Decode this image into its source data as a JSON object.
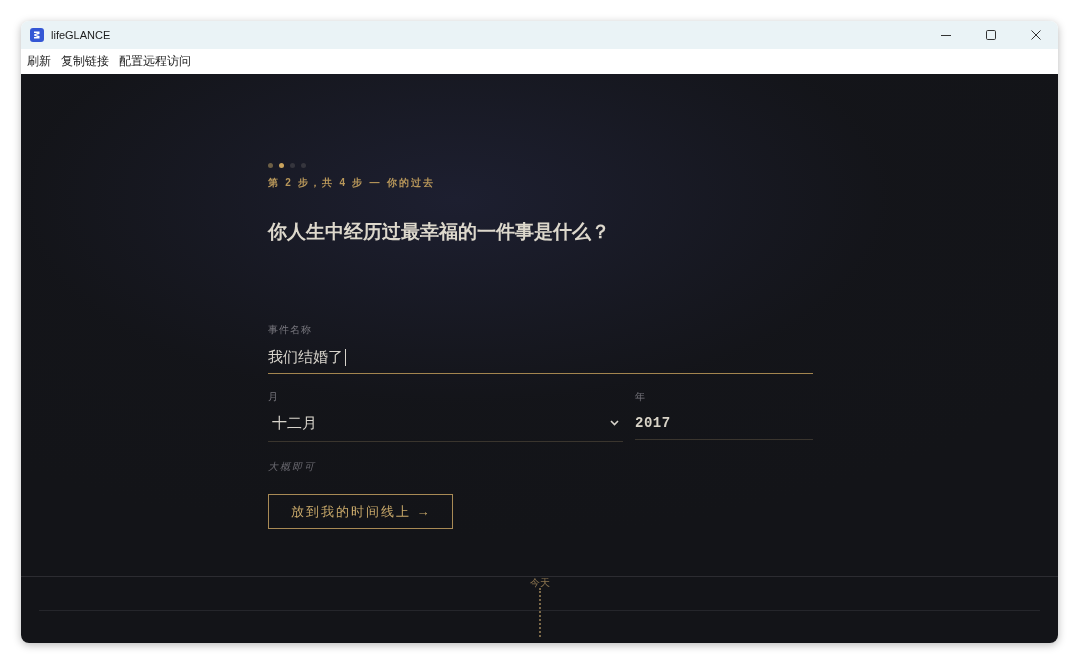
{
  "window": {
    "title": "lifeGLANCE"
  },
  "menu": [
    "刷新",
    "复制链接",
    "配置远程访问"
  ],
  "wizard": {
    "steps": [
      {
        "done": true,
        "selected": false
      },
      {
        "done": false,
        "selected": true
      },
      {
        "done": false,
        "selected": false
      },
      {
        "done": false,
        "selected": false
      }
    ],
    "step_label": "第 2 步，共 4 步 — 你的过去",
    "question": "你人生中经历过最幸福的一件事是什么？",
    "event_name": {
      "label": "事件名称",
      "value": "我们结婚了",
      "focused": true
    },
    "month": {
      "label": "月",
      "value": "十二月",
      "focused": false
    },
    "year": {
      "label": "年",
      "value": "2017",
      "focused": false
    },
    "hint": "大概即可",
    "submit": "放到我的时间线上 →"
  },
  "timeline": {
    "today_label": "今天"
  }
}
